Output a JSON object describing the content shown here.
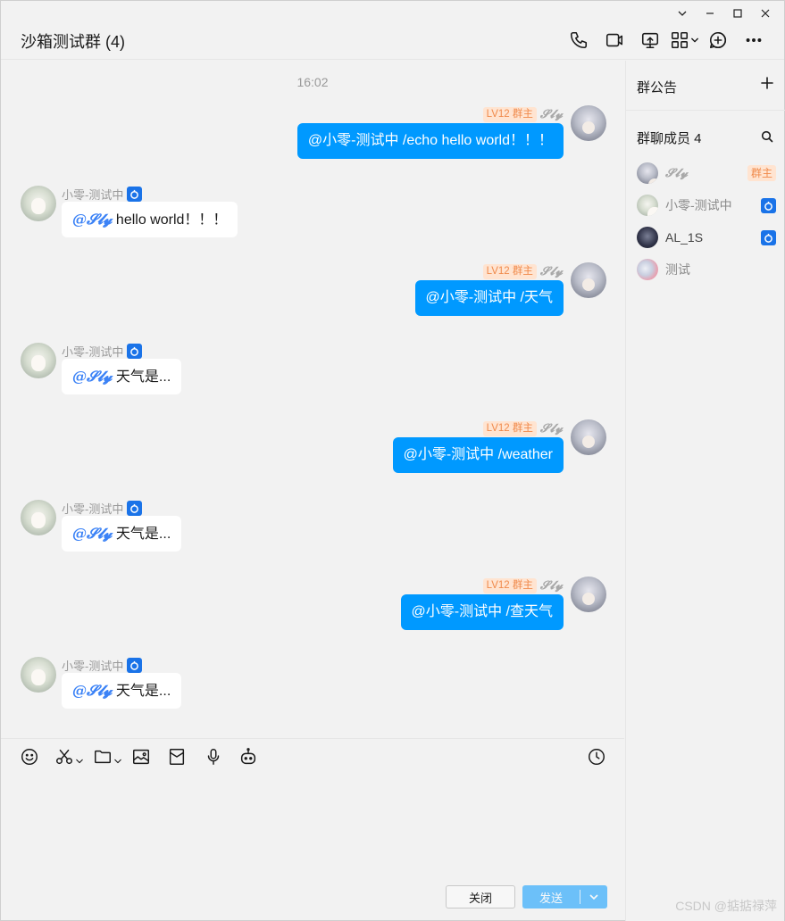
{
  "header": {
    "title": "沙箱测试群 (4)"
  },
  "chat": {
    "timestamp": "16:02",
    "outgoing": [
      {
        "level": "LV12 群主",
        "sender": "𝓢𝓵𝔂",
        "text": "@小零-测试中 /echo hello world！！！"
      },
      {
        "level": "LV12 群主",
        "sender": "𝓢𝓵𝔂",
        "text": "@小零-测试中 /天气"
      },
      {
        "level": "LV12 群主",
        "sender": "𝓢𝓵𝔂",
        "text": "@小零-测试中 /weather"
      },
      {
        "level": "LV12 群主",
        "sender": "𝓢𝓵𝔂",
        "text": "@小零-测试中 /查天气"
      }
    ],
    "incoming": [
      {
        "sender": "小零-测试中",
        "mention": "@𝓢𝓵𝔂",
        "text": " hello world！！！"
      },
      {
        "sender": "小零-测试中",
        "mention": "@𝓢𝓵𝔂",
        "text": " 天气是..."
      },
      {
        "sender": "小零-测试中",
        "mention": "@𝓢𝓵𝔂",
        "text": " 天气是..."
      },
      {
        "sender": "小零-测试中",
        "mention": "@𝓢𝓵𝔂",
        "text": " 天气是..."
      }
    ]
  },
  "composer": {
    "close_label": "关闭",
    "send_label": "发送"
  },
  "sidebar": {
    "announcement_title": "群公告",
    "members_title": "群聊成员 4",
    "members": [
      {
        "name": "𝓢𝓵𝔂",
        "tag": "群主"
      },
      {
        "name": "小零-测试中",
        "tag": "bot"
      },
      {
        "name": "AL_1S",
        "tag": "bot"
      },
      {
        "name": "测试",
        "tag": ""
      }
    ]
  },
  "watermark": "CSDN @掂掂禄萍",
  "colors": {
    "accent": "#0099ff",
    "owner_tag_bg": "#ffe4d1",
    "owner_tag_fg": "#f08a4b",
    "bot_badge": "#1a73e8",
    "mention": "#3b82f6"
  }
}
